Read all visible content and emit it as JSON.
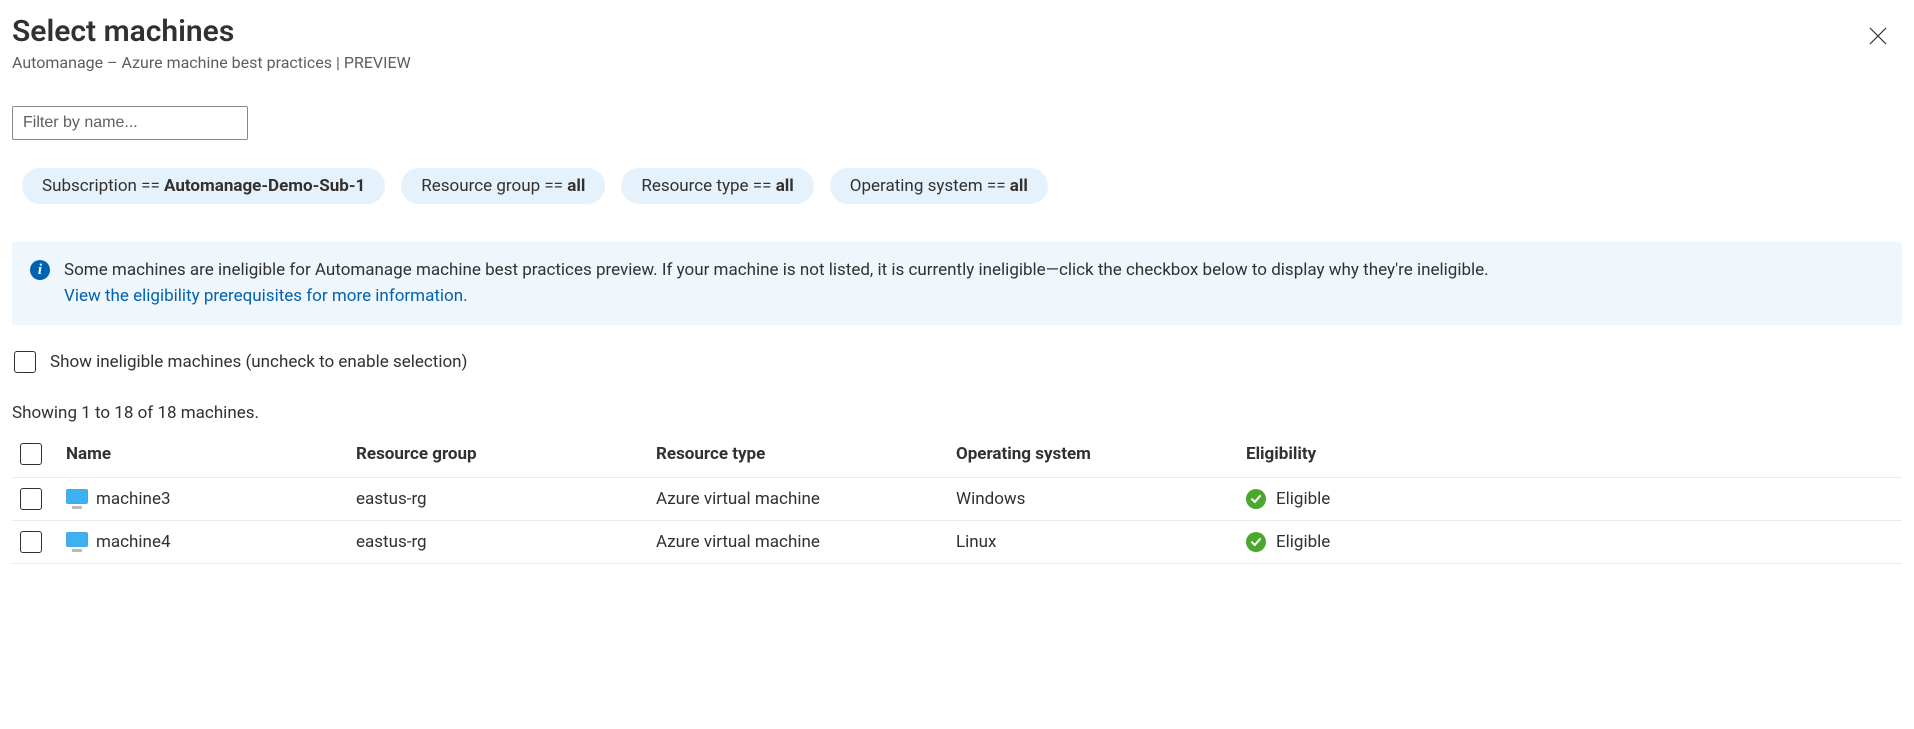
{
  "header": {
    "title": "Select machines",
    "subtitle": "Automanage – Azure machine best practices | PREVIEW"
  },
  "search": {
    "placeholder": "Filter by name..."
  },
  "pills": [
    {
      "label": "Subscription",
      "op": "==",
      "value": "Automanage-Demo-Sub-1"
    },
    {
      "label": "Resource group",
      "op": "==",
      "value": "all"
    },
    {
      "label": "Resource type",
      "op": "==",
      "value": "all"
    },
    {
      "label": "Operating system",
      "op": "==",
      "value": "all"
    }
  ],
  "banner": {
    "text": "Some machines are ineligible for Automanage machine best practices preview. If your machine is not listed, it is currently ineligible—click the checkbox below to display why they're ineligible.",
    "link": "View the eligibility prerequisites for more information."
  },
  "ineligible_toggle": {
    "label": "Show ineligible machines (uncheck to enable selection)"
  },
  "result_count": "Showing 1 to 18 of 18 machines.",
  "table": {
    "headers": {
      "name": "Name",
      "resource_group": "Resource group",
      "resource_type": "Resource type",
      "os": "Operating system",
      "eligibility": "Eligibility"
    }
  },
  "rows": [
    {
      "name": "machine3",
      "resource_group": "eastus-rg",
      "resource_type": "Azure virtual machine",
      "os": "Windows",
      "eligibility": "Eligible"
    },
    {
      "name": "machine4",
      "resource_group": "eastus-rg",
      "resource_type": "Azure virtual machine",
      "os": "Linux",
      "eligibility": "Eligible"
    }
  ]
}
